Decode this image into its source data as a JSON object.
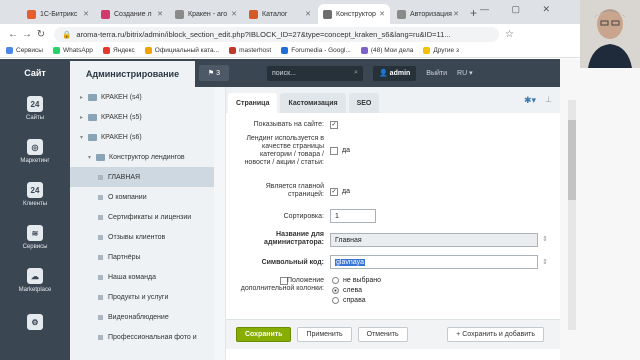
{
  "browser": {
    "tabs": [
      {
        "label": "1С-Битрикс",
        "color": "#e85d2f",
        "active": false
      },
      {
        "label": "Создание л",
        "color": "#d23a6b",
        "active": false
      },
      {
        "label": "Кракен - аго",
        "color": "#8a8a8a",
        "active": false
      },
      {
        "label": "Каталог",
        "color": "#d45a28",
        "active": false
      },
      {
        "label": "Конструктор",
        "color": "#6e6e6e",
        "active": true
      },
      {
        "label": "Авторизация",
        "color": "#8a8a8a",
        "active": false
      }
    ],
    "url": "aroma-terra.ru/bitrix/admin/iblock_section_edit.php?IBLOCK_ID=27&type=concept_kraken_s6&lang=ru&ID=11...",
    "bookmarks": [
      {
        "label": "Сервисы",
        "color": "#4a86e8"
      },
      {
        "label": "WhatsApp",
        "color": "#25d366"
      },
      {
        "label": "Яндекс",
        "color": "#e6372b"
      },
      {
        "label": "Официальный ката...",
        "color": "#f2a300"
      },
      {
        "label": "masterhost",
        "color": "#c0392b"
      },
      {
        "label": "Forumedia - Googl...",
        "color": "#1e6fd9"
      },
      {
        "label": "(48) Мои дела",
        "color": "#7b61c9"
      },
      {
        "label": "Другие з",
        "color": "#f2c200"
      }
    ]
  },
  "admin": {
    "site_button": "Сайт",
    "admin_button": "Администрирование",
    "notifications": "3",
    "search_placeholder": "поиск...",
    "user": "admin",
    "logout": "Выйти",
    "lang": "RU"
  },
  "sidebar": [
    {
      "label": "Сайты",
      "icon": "24"
    },
    {
      "label": "Маркетинг",
      "icon": "◎"
    },
    {
      "label": "Клиенты",
      "icon": "24"
    },
    {
      "label": "Сервисы",
      "icon": "≋"
    },
    {
      "label": "Marketplace",
      "icon": "☁"
    },
    {
      "label": "",
      "icon": "⚙"
    }
  ],
  "tree": [
    {
      "label": "КРАКЕН (s4)",
      "level": 0,
      "selected": false
    },
    {
      "label": "КРАКЕН (s5)",
      "level": 0,
      "selected": false
    },
    {
      "label": "КРАКЕН (s6)",
      "level": 0,
      "selected": false
    },
    {
      "label": "Конструктор лендингов",
      "level": 1,
      "selected": false
    },
    {
      "label": "ГЛАВНАЯ",
      "level": 2,
      "selected": true
    },
    {
      "label": "О компании",
      "level": 2,
      "selected": false
    },
    {
      "label": "Сертификаты и лицензии",
      "level": 2,
      "selected": false
    },
    {
      "label": "Отзывы клиентов",
      "level": 2,
      "selected": false
    },
    {
      "label": "Партнёры",
      "level": 2,
      "selected": false
    },
    {
      "label": "Наша команда",
      "level": 2,
      "selected": false
    },
    {
      "label": "Продукты и услуги",
      "level": 2,
      "selected": false
    },
    {
      "label": "Видеонаблюдение",
      "level": 2,
      "selected": false
    },
    {
      "label": "Профессиональная фото и",
      "level": 2,
      "selected": false
    }
  ],
  "content_tabs": [
    "Страница",
    "Кастомизация",
    "SEO"
  ],
  "form": {
    "show_on_site_label": "Показывать на сайте:",
    "landing_used_label": "Лендинг используется в качестве страницы категории / товара / новости / акции / статьи:",
    "landing_used_value": "да",
    "is_home_label": "Является главной страницей:",
    "is_home_value": "да",
    "sort_label": "Сортировка:",
    "sort_value": "1",
    "admin_name_label": "Название для администратора:",
    "admin_name_value": "Главная",
    "code_label": "Символьный код:",
    "code_value": "glavnaya",
    "column_label": "Положение дополнительной колонки:",
    "column_options": [
      "не выбрано",
      "слева",
      "справа"
    ],
    "column_selected": "слева"
  },
  "actions": {
    "save": "Сохранить",
    "apply": "Применить",
    "cancel": "Отменить",
    "save_add": "+ Сохранить и добавить"
  }
}
